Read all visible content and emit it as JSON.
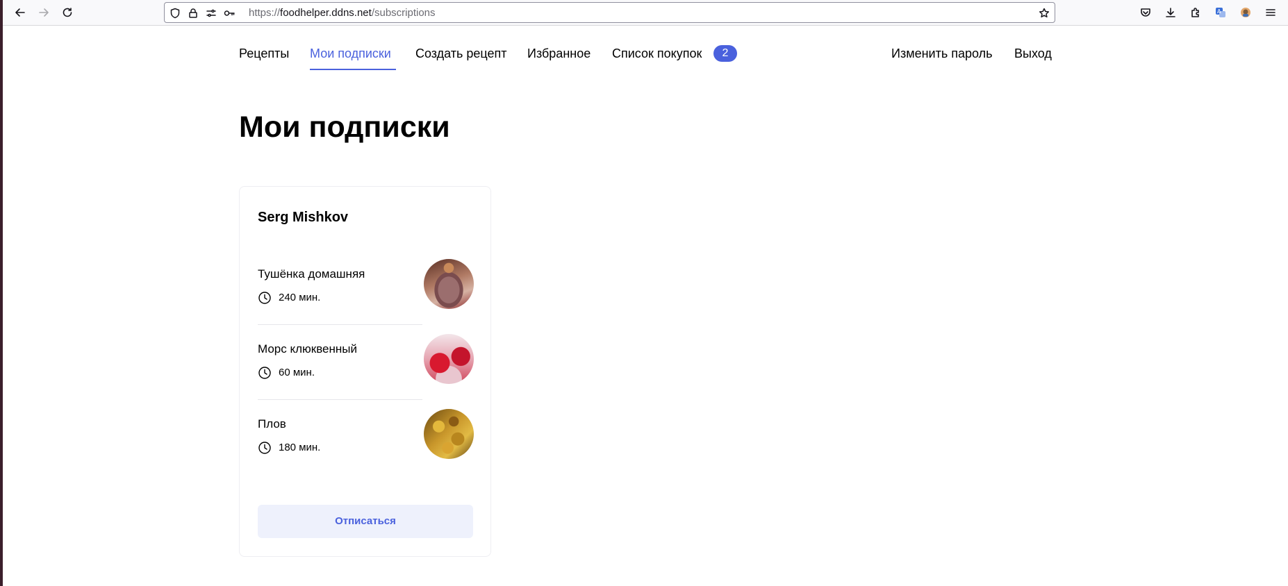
{
  "browser": {
    "url_scheme": "https://",
    "url_host": "foodhelper.ddns.net",
    "url_path": "/subscriptions"
  },
  "nav": {
    "recipes": "Рецепты",
    "subscriptions": "Мои подписки",
    "create_recipe": "Создать рецепт",
    "favorites": "Избранное",
    "shopping_list": "Список покупок",
    "shopping_count": "2",
    "change_password": "Изменить пароль",
    "logout": "Выход"
  },
  "page": {
    "title": "Мои подписки"
  },
  "subscriptions": [
    {
      "author": "Serg Mishkov",
      "recipes": [
        {
          "name": "Тушёнка домашняя",
          "time": "240 мин.",
          "image": "stew-photo"
        },
        {
          "name": "Морс клюквенный",
          "time": "60 мин.",
          "image": "cranberry-drink-photo"
        },
        {
          "name": "Плов",
          "time": "180 мин.",
          "image": "plov-photo"
        }
      ],
      "unsubscribe_label": "Отписаться"
    }
  ],
  "colors": {
    "accent": "#4a61dd",
    "button_bg": "#eef1fc"
  },
  "icons": [
    "back-icon",
    "forward-icon",
    "reload-icon",
    "shield-icon",
    "lock-icon",
    "permissions-icon",
    "key-icon",
    "bookmark-star-icon",
    "pocket-icon",
    "download-icon",
    "extensions-icon",
    "translate-icon",
    "account-icon",
    "menu-icon",
    "clock-icon"
  ]
}
